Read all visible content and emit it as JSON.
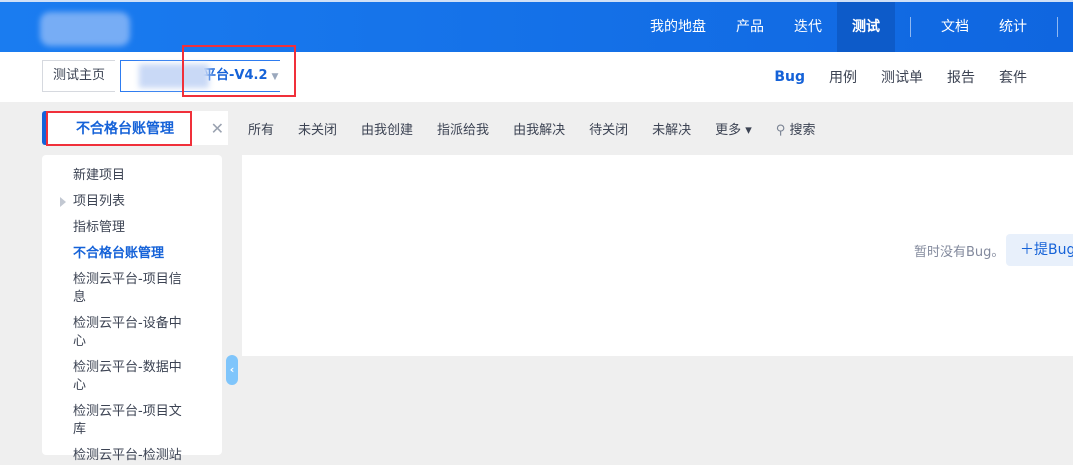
{
  "header": {
    "nav": [
      {
        "label": "我的地盘"
      },
      {
        "label": "产品"
      },
      {
        "label": "迭代"
      },
      {
        "label": "测试",
        "active": true
      },
      {
        "label": "文档"
      },
      {
        "label": "统计"
      }
    ]
  },
  "breadcrumb": {
    "home": "测试主页",
    "product": "平台-V4.2"
  },
  "subnav": {
    "items": [
      "Bug",
      "用例",
      "测试单",
      "报告",
      "套件"
    ]
  },
  "tabs": {
    "current": "不合格台账管理",
    "close": "✕",
    "filters": [
      "所有",
      "未关闭",
      "由我创建",
      "指派给我",
      "由我解决",
      "待关闭",
      "未解决",
      "更多 ▾",
      "搜索"
    ]
  },
  "sidebar": {
    "items": [
      "新建项目",
      "项目列表",
      "指标管理",
      "不合格台账管理",
      "检测云平台-项目信息",
      "检测云平台-设备中心",
      "检测云平台-数据中心",
      "检测云平台-项目文库",
      "检测云平台-检测站"
    ]
  },
  "content": {
    "empty_text": "暂时没有Bug。",
    "add_button": "提Bug"
  },
  "colors": {
    "brand": "#1470e6",
    "accent": "#1562d8",
    "highlight": "#f0303a"
  }
}
